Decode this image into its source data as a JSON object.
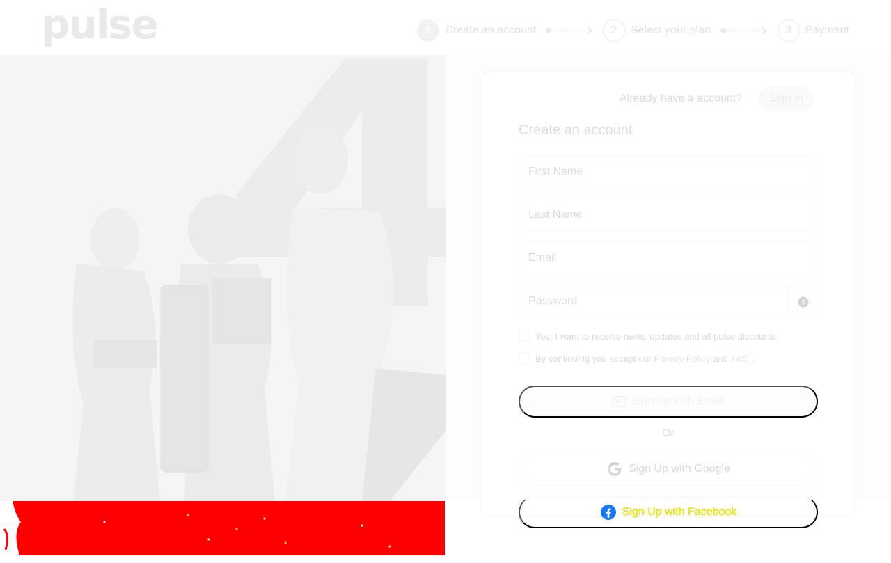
{
  "header": {
    "logo": "pulse",
    "steps": [
      {
        "num": "1",
        "label": "Create an account",
        "active": true
      },
      {
        "num": "2",
        "label": "Select your plan",
        "active": false
      },
      {
        "num": "3",
        "label": "Payment",
        "active": false
      }
    ]
  },
  "card": {
    "already_text": "Already have a account?",
    "signin_label": "Sign In",
    "title": "Create an account",
    "fields": {
      "first_name_placeholder": "First Name",
      "last_name_placeholder": "Last Name",
      "email_placeholder": "Email",
      "password_placeholder": "Password"
    },
    "news_checkbox_label": "Yes, I want to receive news, updates and all pulse discounts.",
    "terms": {
      "prefix": "By continuing you accept our",
      "privacy_link": "Privacy Policy",
      "and": "and",
      "tc_link": "T&C",
      "suffix": "."
    },
    "email_button": "Sign Up with Email",
    "or_text": "Or",
    "google_button": "Sign Up with Google",
    "facebook_button": "Sign Up with Facebook"
  },
  "colors": {
    "facebook_blue": "#1877f2",
    "red_strip": "#ff0000",
    "facebook_text": "#f0f000"
  },
  "icons": [
    "info-icon",
    "mail-icon",
    "google-icon",
    "facebook-icon",
    "arrow-connector-icon"
  ]
}
